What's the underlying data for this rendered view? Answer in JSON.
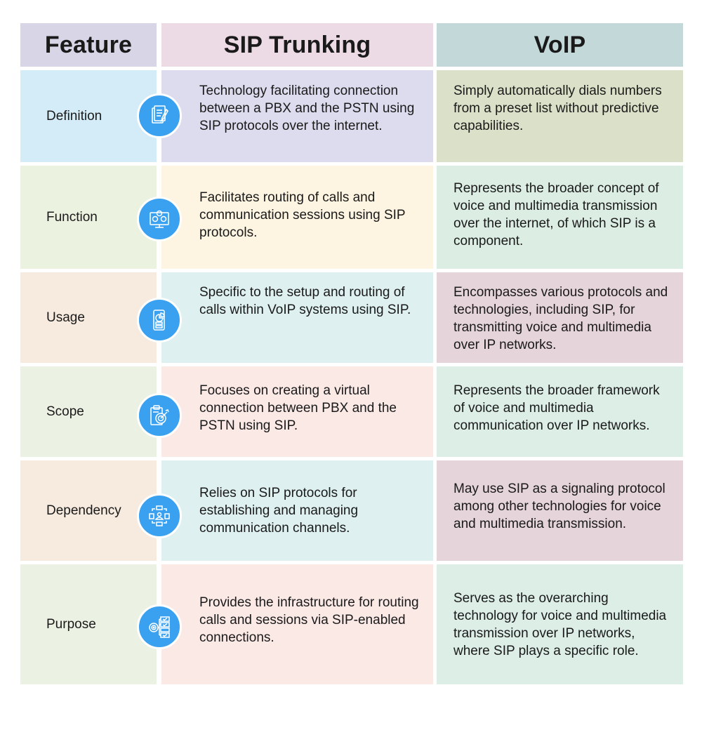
{
  "header": {
    "feature": "Feature",
    "sip": "SIP Trunking",
    "voip": "VoIP"
  },
  "colors": {
    "header_feature": "#d7d5e6",
    "header_sip": "#ecdbe4",
    "header_voip": "#c3d9d9",
    "icon_circle": "#3aa0f0"
  },
  "rows": [
    {
      "feature": "Definition",
      "icon": "document-edit-icon",
      "sip": "Technology facilitating connection between a PBX and the PSTN using SIP protocols over the internet.",
      "voip": "Simply automatically dials numbers from a preset list without predictive capabilities."
    },
    {
      "feature": "Function",
      "icon": "monitor-gears-icon",
      "sip": "Facilitates routing of calls and communication sessions using SIP protocols.",
      "voip": "Represents the broader concept of voice and multimedia transmission over the internet, of which SIP is a component."
    },
    {
      "feature": "Usage",
      "icon": "mobile-chart-icon",
      "sip": "Specific to the setup and routing of calls within VoIP systems using SIP.",
      "voip": "Encompasses various protocols and technologies, including SIP, for transmitting voice and multimedia over IP networks."
    },
    {
      "feature": "Scope",
      "icon": "clipboard-target-icon",
      "sip": "Focuses on creating a virtual connection between PBX and the PSTN using SIP.",
      "voip": "Represents the broader framework of voice and multimedia communication over IP networks."
    },
    {
      "feature": "Dependency",
      "icon": "network-hierarchy-icon",
      "sip": "Relies on SIP protocols for establishing and managing communication channels.",
      "voip": "May use SIP as a signaling protocol among other technologies for voice and multimedia transmission."
    },
    {
      "feature": "Purpose",
      "icon": "target-checklist-icon",
      "sip": "Provides the infrastructure for routing calls and sessions via SIP-enabled connections.",
      "voip": "Serves as the overarching technology for voice and multimedia transmission over IP networks, where SIP plays a specific role."
    }
  ]
}
